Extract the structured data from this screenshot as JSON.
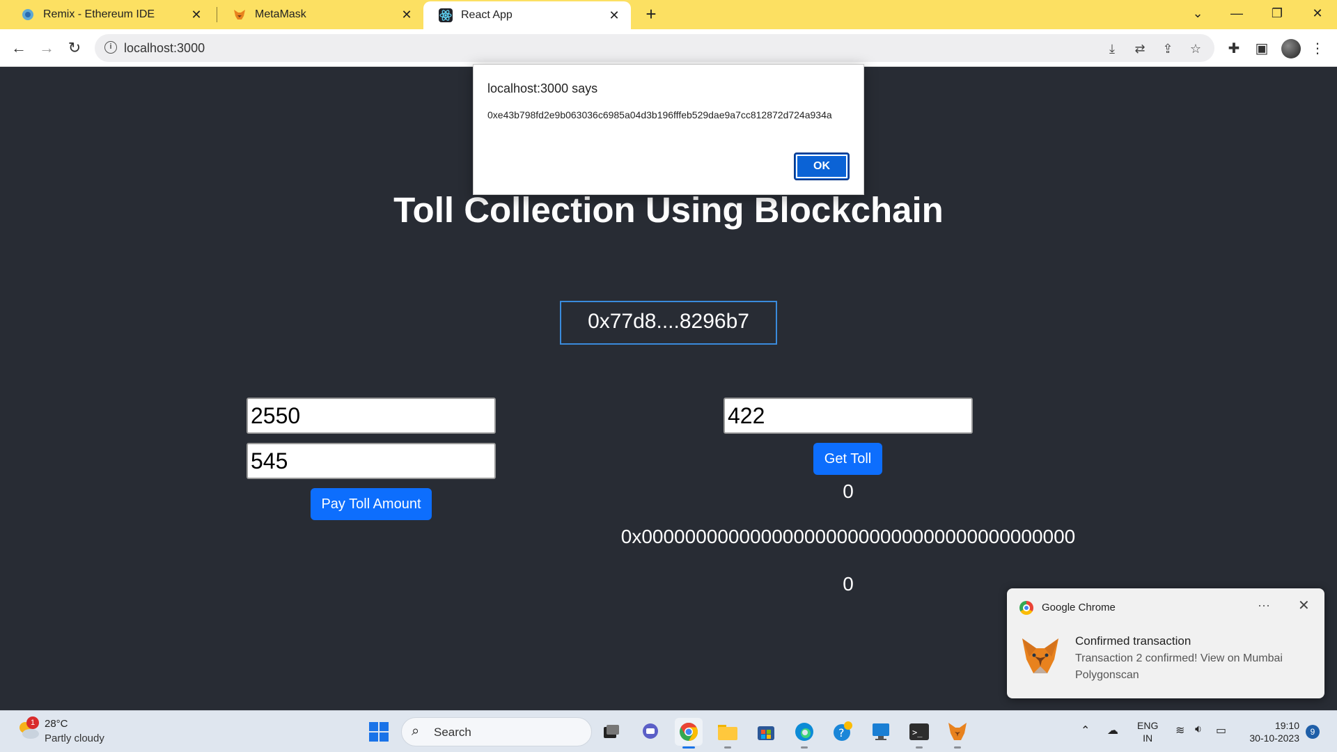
{
  "browser": {
    "tabs": [
      {
        "label": "Remix - Ethereum IDE",
        "icon": "remix-icon"
      },
      {
        "label": "MetaMask",
        "icon": "metamask-fox-icon"
      },
      {
        "label": "React App",
        "icon": "react-icon",
        "active": true
      }
    ],
    "url": "localhost:3000"
  },
  "dialog": {
    "title": "localhost:3000 says",
    "message": "0xe43b798fd2e9b063036c6985a04d3b196fffeb529dae9a7cc812872d724a934a",
    "ok_label": "OK"
  },
  "app": {
    "title": "Toll Collection Using Blockchain",
    "account": "0x77d8....8296b7",
    "pay": {
      "input1_value": "2550",
      "input2_value": "545",
      "button_label": "Pay Toll Amount"
    },
    "get": {
      "input_value": "422",
      "button_label": "Get Toll",
      "result_amount": "0",
      "result_address": "0x0000000000000000000000000000000000000000",
      "result_extra": "0"
    }
  },
  "notification": {
    "app_name": "Google Chrome",
    "more": "···",
    "heading": "Confirmed transaction",
    "body": "Transaction 2 confirmed! View on Mumbai Polygonscan"
  },
  "taskbar": {
    "weather_temp": "28°C",
    "weather_condition": "Partly cloudy",
    "weather_badge": "1",
    "search_placeholder": "Search",
    "lang_line1": "ENG",
    "lang_line2": "IN",
    "time": "19:10",
    "date": "30-10-2023",
    "notification_count": "9"
  },
  "colors": {
    "tabstrip": "#fce062",
    "page_bg": "#282c34",
    "button_blue": "#0d6efd",
    "account_border": "#3a8bdc"
  }
}
